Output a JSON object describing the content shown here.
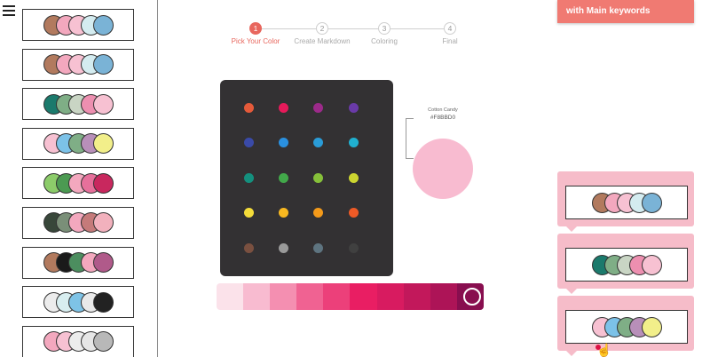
{
  "sidebar": {
    "palettes": [
      [
        "#b27a5e",
        "#f3a8be",
        "#f7c1d2",
        "#d4ecf0",
        "#7ab3d6"
      ],
      [
        "#b27a5e",
        "#f3a8be",
        "#f7c1d2",
        "#d4ecf0",
        "#7ab3d6"
      ],
      [
        "#1b7a6c",
        "#7fae86",
        "#c9d5c4",
        "#ed8fb0",
        "#f7c1d2"
      ],
      [
        "#f7c1d2",
        "#7cc2e8",
        "#7fae86",
        "#b88fb9",
        "#f2ef8a"
      ],
      [
        "#8ccc6a",
        "#4c9a52",
        "#f3a8be",
        "#e6709b",
        "#c8285e"
      ],
      [
        "#38473a",
        "#7a8f78",
        "#f3a8be",
        "#c57a7a",
        "#f2b1bd"
      ],
      [
        "#b27a5e",
        "#1a1a1a",
        "#4c8e5f",
        "#f3a8be",
        "#b05a8a"
      ],
      [
        "#ececec",
        "#d8eef0",
        "#7ec3e6",
        "#e9e9e9",
        "#222222"
      ],
      [
        "#f3a8be",
        "#f7c1d2",
        "#ececec",
        "#e6e6e6",
        "#b8b8b8"
      ]
    ]
  },
  "stepper": {
    "steps": [
      {
        "num": "1",
        "label": "Pick Your Color"
      },
      {
        "num": "2",
        "label": "Create Markdown"
      },
      {
        "num": "3",
        "label": "Coloring"
      },
      {
        "num": "4",
        "label": "Final"
      }
    ]
  },
  "color_grid": [
    [
      "#e55a3a",
      "#e61a5a",
      "#9c2a8a",
      "#6a3aa8"
    ],
    [
      "#3a4aa8",
      "#2a90e0",
      "#2a9cd8",
      "#20b0d0"
    ],
    [
      "#14907e",
      "#42a84a",
      "#86c03a",
      "#ccd530"
    ],
    [
      "#f4dc3a",
      "#f8b820",
      "#f49a1a",
      "#ee5a26"
    ],
    [
      "#7a5040",
      "#9a9a9a",
      "#5e7480",
      "#404040"
    ]
  ],
  "selected": {
    "name": "Cotton Candy",
    "hex": "#F8BBD0",
    "color": "#f8bbd0"
  },
  "shades": [
    "#fbe2ea",
    "#f8bbd0",
    "#f48fb1",
    "#f06292",
    "#ec407a",
    "#e91e63",
    "#d81b60",
    "#c2185b",
    "#ad1457",
    "#880e4f"
  ],
  "banner": {
    "text": "with Main keywords"
  },
  "right_cards": [
    [
      "#b27a5e",
      "#f3a8be",
      "#f7c1d2",
      "#d4ecf0",
      "#7ab3d6"
    ],
    [
      "#1b7a6c",
      "#7fae86",
      "#c9d5c4",
      "#ed8fb0",
      "#f7c1d2"
    ],
    [
      "#f7c1d2",
      "#7cc2e8",
      "#7fae86",
      "#b88fb9",
      "#f2ef8a"
    ]
  ],
  "icons": {
    "menu": "hamburger-icon",
    "cursor": "hand-pointer-icon"
  }
}
